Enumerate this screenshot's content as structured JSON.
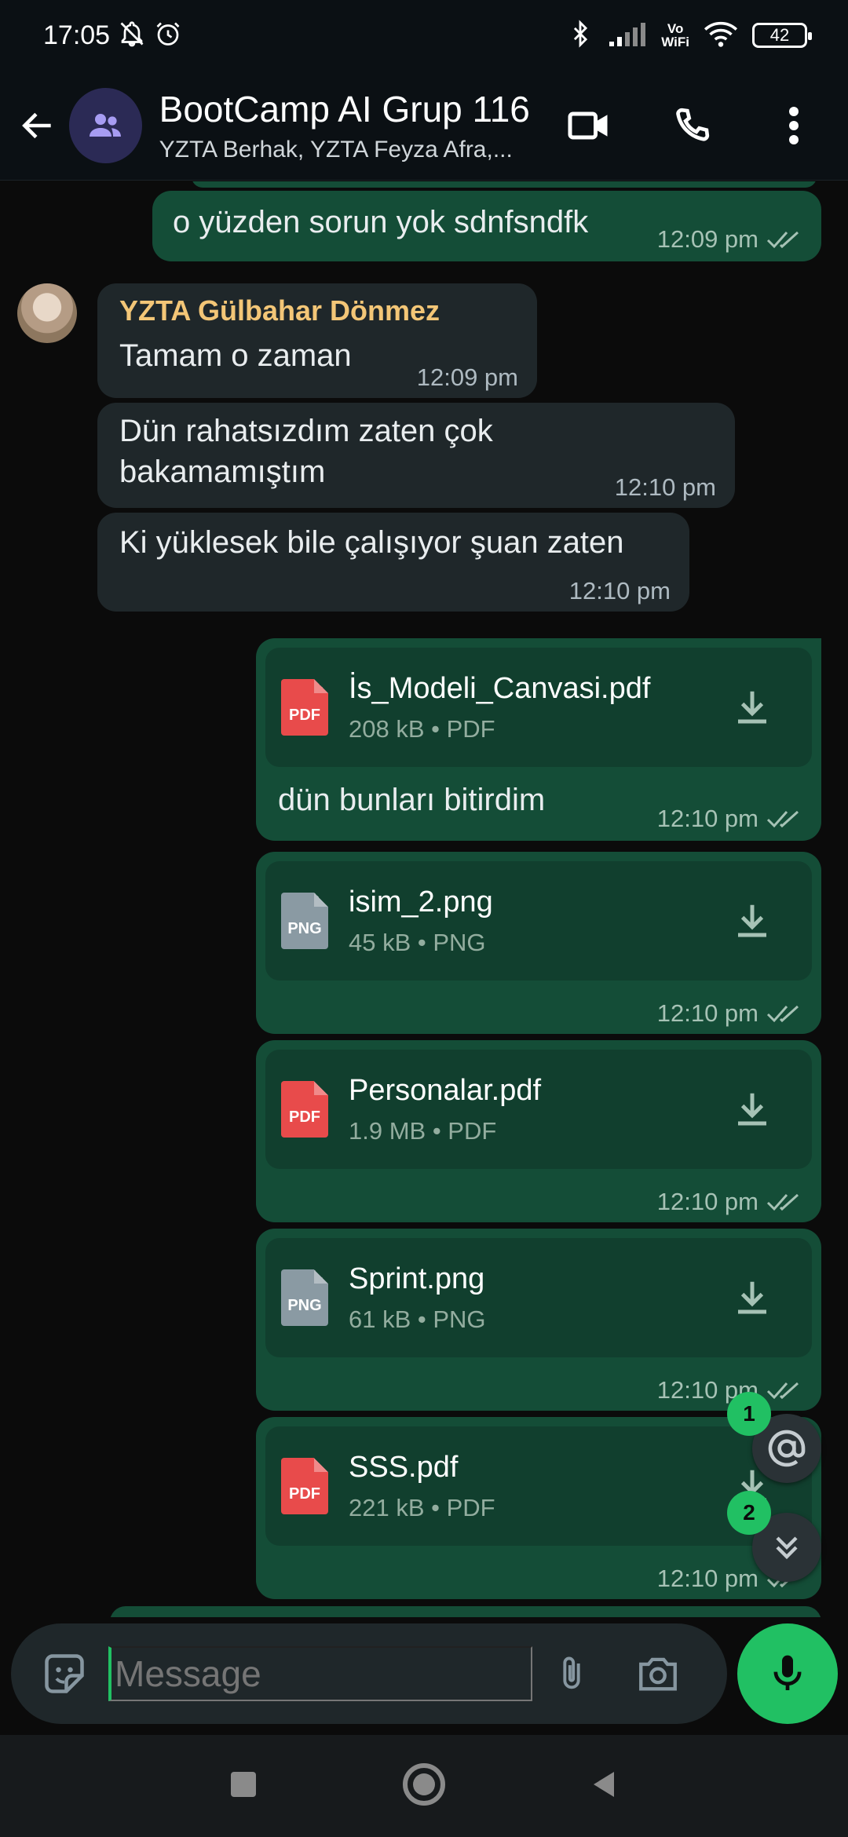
{
  "status_bar": {
    "time": "17:05",
    "battery": "42",
    "network_label_top": "Vo",
    "network_label_bottom": "WiFi"
  },
  "header": {
    "title": "BootCamp AI Grup 116",
    "subtitle": "YZTA Berhak, YZTA Feyza Afra,..."
  },
  "messages": [
    {
      "type": "text",
      "direction": "out",
      "text": "o yüzden sorun yok sdnfsndfk",
      "time": "12:09 pm",
      "read": true
    },
    {
      "type": "text",
      "direction": "in",
      "sender": "YZTA Gülbahar Dönmez",
      "text": "Tamam o zaman",
      "time": "12:09 pm"
    },
    {
      "type": "text",
      "direction": "in",
      "text": "Dün rahatsızdım zaten çok bakamamıştım",
      "time": "12:10 pm"
    },
    {
      "type": "text",
      "direction": "in",
      "text": "Ki yüklesek bile çalışıyor şuan zaten",
      "time": "12:10 pm"
    },
    {
      "type": "file",
      "direction": "out",
      "file_name": "İs_Modeli_Canvasi.pdf",
      "file_meta": "208 kB • PDF",
      "file_type": "PDF",
      "caption": "dün bunları bitirdim",
      "time": "12:10 pm",
      "read": true
    },
    {
      "type": "file",
      "direction": "out",
      "file_name": "isim_2.png",
      "file_meta": "45 kB • PNG",
      "file_type": "PNG",
      "time": "12:10 pm",
      "read": true
    },
    {
      "type": "file",
      "direction": "out",
      "file_name": "Personalar.pdf",
      "file_meta": "1.9 MB • PDF",
      "file_type": "PDF",
      "time": "12:10 pm",
      "read": true
    },
    {
      "type": "file",
      "direction": "out",
      "file_name": "Sprint.png",
      "file_meta": "61 kB • PNG",
      "file_type": "PNG",
      "time": "12:10 pm",
      "read": true
    },
    {
      "type": "file",
      "direction": "out",
      "file_name": "SSS.pdf",
      "file_meta": "221 kB • PDF",
      "file_type": "PDF",
      "time": "12:10 pm",
      "read": true
    }
  ],
  "floating": {
    "mention_count": "1",
    "unread_count": "2"
  },
  "composer": {
    "placeholder": "Message"
  },
  "colors": {
    "accent": "#21c063",
    "outgoing_bubble": "#144d37",
    "incoming_bubble": "#1f272a",
    "sender_name": "#f3c677",
    "read_ticks": "#a6c2b5"
  }
}
